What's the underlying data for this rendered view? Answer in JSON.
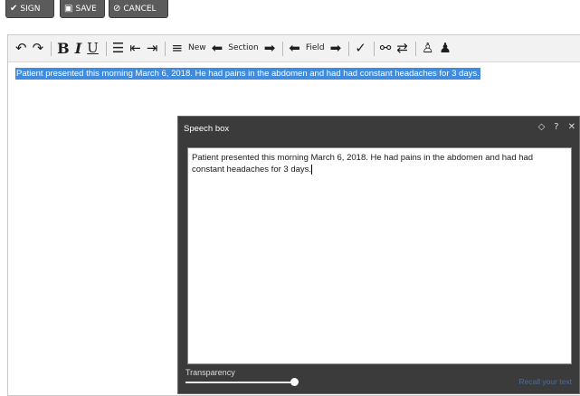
{
  "actions": {
    "sign": "SIGN",
    "save": "SAVE",
    "cancel": "CANCEL"
  },
  "toolbar": {
    "new": "New",
    "section": "Section",
    "field": "Field"
  },
  "document": {
    "text": "Patient presented this morning March 6, 2018.  He had pains in the abdomen and had had constant headaches for 3 days."
  },
  "speech_box": {
    "title": "Speech box",
    "text": "Patient presented this morning March 6, 2018.  He had pains in the abdomen and had had constant headaches for 3 days.",
    "transparency_label": "Transparency",
    "transparency_level": 1.0,
    "recall_label": "Recall your text"
  },
  "colors": {
    "selection": "#3f8be0",
    "speech_bg": "#3b3b3b",
    "button_bg": "#5b5b5b"
  }
}
